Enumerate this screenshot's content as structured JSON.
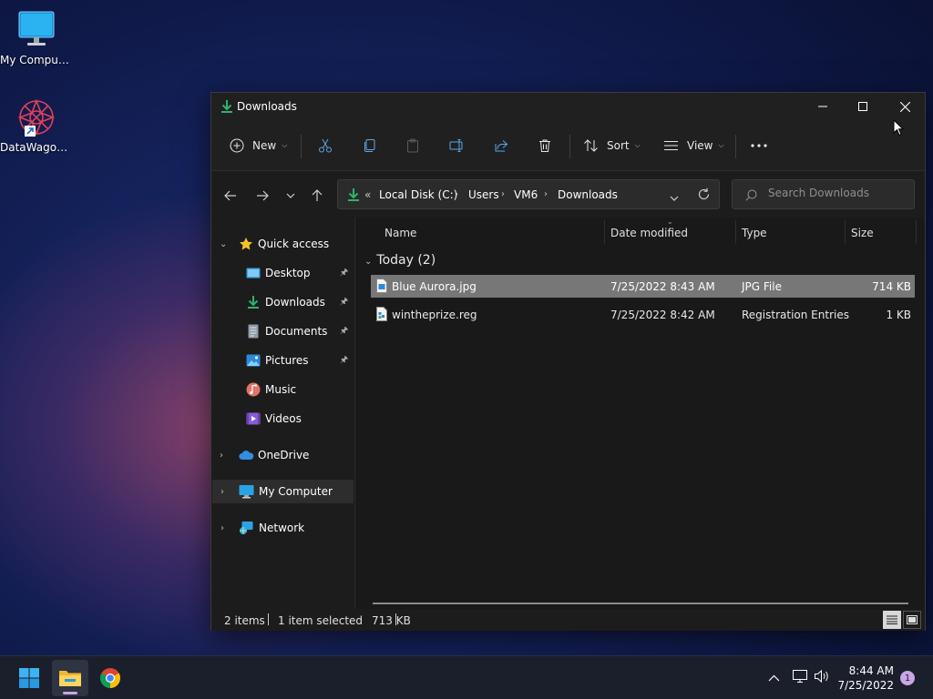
{
  "desktop": {
    "icons": [
      {
        "label": "My Computer",
        "icon": "monitor-icon"
      },
      {
        "label": "DataWagon...",
        "icon": "datawagon-shortcut-icon"
      }
    ]
  },
  "window": {
    "title": "Downloads",
    "title_icon": "download-arrow-icon"
  },
  "toolbar": {
    "new_label": "New",
    "sort_label": "Sort",
    "view_label": "View",
    "buttons": [
      "cut-icon",
      "copy-icon",
      "paste-icon",
      "rename-icon",
      "share-icon",
      "delete-icon"
    ],
    "more_icon": "more-icon"
  },
  "address": {
    "overflow": "«",
    "crumbs": [
      "Local Disk (C:)",
      "Users",
      "VM6",
      "Downloads"
    ]
  },
  "search": {
    "placeholder": "Search Downloads"
  },
  "sidebar": {
    "quick_access": "Quick access",
    "pinned": [
      {
        "label": "Desktop",
        "icon": "desktop-folder-icon",
        "pinned": true
      },
      {
        "label": "Downloads",
        "icon": "downloads-folder-icon",
        "pinned": true
      },
      {
        "label": "Documents",
        "icon": "documents-folder-icon",
        "pinned": true
      },
      {
        "label": "Pictures",
        "icon": "pictures-folder-icon",
        "pinned": true
      },
      {
        "label": "Music",
        "icon": "music-folder-icon",
        "pinned": false
      },
      {
        "label": "Videos",
        "icon": "videos-folder-icon",
        "pinned": false
      }
    ],
    "onedrive": "OneDrive",
    "my_computer": "My Computer",
    "network": "Network"
  },
  "columns": {
    "name": "Name",
    "date": "Date modified",
    "type": "Type",
    "size": "Size"
  },
  "group": {
    "label": "Today (2)"
  },
  "files": [
    {
      "name": "Blue Aurora.jpg",
      "date": "7/25/2022 8:43 AM",
      "type": "JPG File",
      "size": "714 KB",
      "selected": true,
      "icon": "image-file-icon"
    },
    {
      "name": "wintheprize.reg",
      "date": "7/25/2022 8:42 AM",
      "type": "Registration Entries",
      "size": "1 KB",
      "selected": false,
      "icon": "registry-file-icon"
    }
  ],
  "status": {
    "items": "2 items",
    "selected": "1 item selected",
    "selected_size": "713 KB"
  },
  "taskbar": {
    "time": "8:44 AM",
    "date": "7/25/2022",
    "notifications": "1"
  },
  "colors": {
    "accent_green": "#2fb36b",
    "selection": "#777777",
    "window_bg": "#1c1c1c"
  }
}
